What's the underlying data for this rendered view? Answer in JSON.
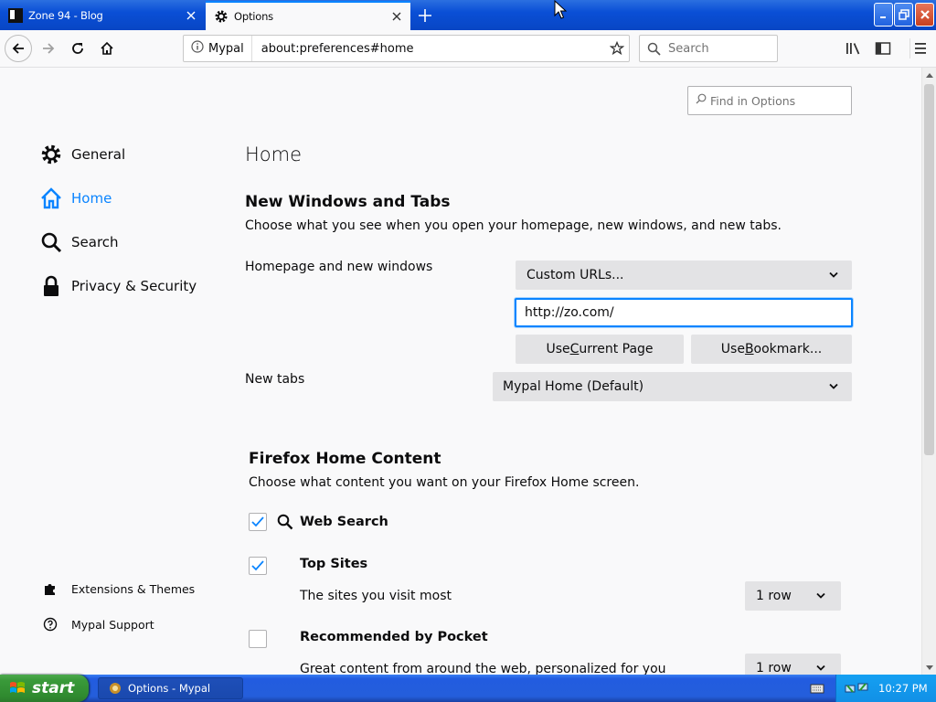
{
  "browser": {
    "tabs": [
      {
        "title": "Zone 94 - Blog",
        "active": false
      },
      {
        "title": "Options",
        "active": true
      }
    ],
    "urlbar": {
      "identity_label": "Mypal",
      "url": "about:preferences#home"
    },
    "search_placeholder": "Search"
  },
  "prefs": {
    "find_placeholder": "Find in Options",
    "categories": [
      {
        "label": "General",
        "icon": "gear-icon"
      },
      {
        "label": "Home",
        "icon": "home-icon",
        "selected": true
      },
      {
        "label": "Search",
        "icon": "search-icon"
      },
      {
        "label": "Privacy & Security",
        "icon": "lock-icon"
      }
    ],
    "footer": {
      "extensions": "Extensions & Themes",
      "support": "Mypal Support"
    },
    "page_title": "Home",
    "section1": {
      "title": "New Windows and Tabs",
      "desc": "Choose what you see when you open your homepage, new windows, and new tabs.",
      "homepage_label": "Homepage and new windows",
      "homepage_mode": "Custom URLs...",
      "homepage_url": "http://zo.com/",
      "use_current_pre": "Use ",
      "use_current_key": "C",
      "use_current_post": "urrent Page",
      "use_bookmark_pre": "Use ",
      "use_bookmark_key": "B",
      "use_bookmark_post": "ookmark...",
      "newtabs_label": "New tabs",
      "newtabs_value": "Mypal Home (Default)"
    },
    "section2": {
      "title": "Firefox Home Content",
      "desc": "Choose what content you want on your Firefox Home screen.",
      "options": [
        {
          "label": "Web Search",
          "checked": true
        },
        {
          "label": "Top Sites",
          "checked": true,
          "desc": "The sites you visit most",
          "rows": "1 row"
        },
        {
          "label": "Recommended by Pocket",
          "checked": false,
          "desc": "Great content from around the web, personalized for you",
          "rows": "1 row"
        }
      ]
    }
  },
  "taskbar": {
    "start_label": "start",
    "task_label": "Options - Mypal",
    "clock": "10:27 PM"
  },
  "colors": {
    "accent": "#0a84ff",
    "taskbar": "#245edb",
    "start": "#3a9a3a"
  }
}
